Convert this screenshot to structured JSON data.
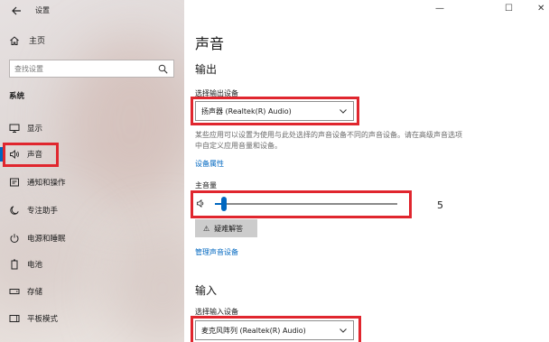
{
  "app": {
    "title": "设置",
    "back_icon": "arrow-left-icon"
  },
  "sidebar": {
    "home_label": "主页",
    "search_placeholder": "查找设置",
    "section": "系统",
    "items": [
      {
        "label": "显示",
        "icon": "monitor-icon"
      },
      {
        "label": "声音",
        "icon": "speaker-icon",
        "active": true
      },
      {
        "label": "通知和操作",
        "icon": "notification-icon"
      },
      {
        "label": "专注助手",
        "icon": "moon-icon"
      },
      {
        "label": "电源和睡眠",
        "icon": "power-icon"
      },
      {
        "label": "电池",
        "icon": "battery-icon"
      },
      {
        "label": "存储",
        "icon": "storage-icon"
      },
      {
        "label": "平板模式",
        "icon": "tablet-icon"
      }
    ]
  },
  "window_controls": {
    "minimize": "—",
    "maximize": "☐",
    "close": "✕"
  },
  "main": {
    "title": "声音",
    "output": {
      "heading": "输出",
      "select_label": "选择输出设备",
      "selected_device": "扬声器 (Realtek(R) Audio)",
      "description": "某些应用可以设置为使用与此处选择的声音设备不同的声音设备。请在高级声音选项中自定义应用音量和设备。",
      "properties_link": "设备属性",
      "volume_label": "主音量",
      "volume_value": "5",
      "volume_fraction": 0.05,
      "troubleshoot_label": "疑难解答",
      "manage_link": "管理声音设备"
    },
    "input": {
      "heading": "输入",
      "select_label": "选择输入设备",
      "selected_device": "麦克风阵列 (Realtek(R) Audio)"
    }
  },
  "colors": {
    "accent": "#0067c0",
    "highlight": "#e0262e"
  }
}
